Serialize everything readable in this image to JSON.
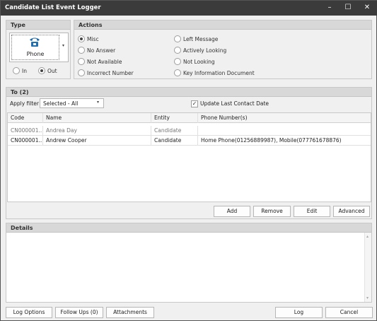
{
  "window": {
    "title": "Candidate List Event Logger",
    "minimize": "–",
    "maximize": "☐",
    "close": "✕"
  },
  "type_panel": {
    "header": "Type",
    "selected_type": "Phone",
    "direction_options": [
      {
        "label": "In",
        "selected": false
      },
      {
        "label": "Out",
        "selected": true
      }
    ]
  },
  "actions_panel": {
    "header": "Actions",
    "options": [
      {
        "label": "Misc",
        "selected": true
      },
      {
        "label": "No Answer",
        "selected": false
      },
      {
        "label": "Not Available",
        "selected": false
      },
      {
        "label": "Incorrect Number",
        "selected": false
      },
      {
        "label": "Left Message",
        "selected": false
      },
      {
        "label": "Actively Looking",
        "selected": false
      },
      {
        "label": "Not Looking",
        "selected": false
      },
      {
        "label": "Key Information Document",
        "selected": false
      }
    ]
  },
  "to_panel": {
    "header": "To (2)",
    "apply_filter_label": "Apply filter",
    "filter_value": "Selected - All",
    "update_last_contact_label": "Update Last Contact Date",
    "update_last_contact_checked": true,
    "columns": [
      "Code",
      "Name",
      "Entity",
      "Phone Number(s)"
    ],
    "rows": [
      {
        "code": "CN000001...",
        "name": "Andrea Day",
        "entity": "Candidate",
        "phone": ""
      },
      {
        "code": "CN000001...",
        "name": "Andrew Cooper",
        "entity": "Candidate",
        "phone": "Home Phone(01256889987), Mobile(077761678876)"
      }
    ],
    "buttons": {
      "add": "Add",
      "remove": "Remove",
      "edit": "Edit",
      "advanced": "Advanced"
    }
  },
  "details_panel": {
    "header": "Details",
    "text": ""
  },
  "footer": {
    "log_options": "Log Options",
    "follow_ups": "Follow Ups (0)",
    "attachments": "Attachments",
    "log": "Log",
    "cancel": "Cancel"
  },
  "colors": {
    "titlebar": "#3b3b3b",
    "panel_header": "#d8d8d8",
    "phone_icon": "#1f6fb2"
  }
}
